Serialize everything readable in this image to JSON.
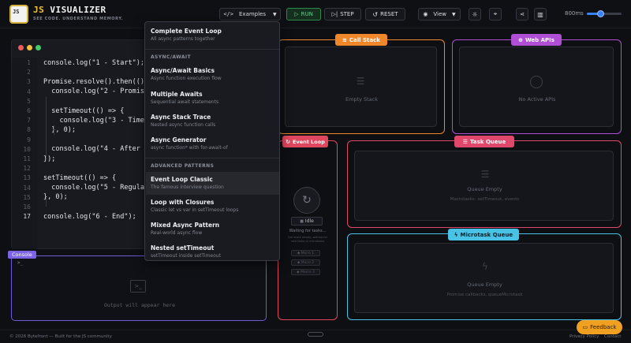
{
  "header": {
    "logo_text": "JS",
    "title_prefix": "JS",
    "title_main": "VISUALIZER",
    "tagline": "SEE CODE. UNDERSTAND MEMORY.",
    "examples_label": "Examples",
    "run_label": "RUN",
    "step_label": "STEP",
    "reset_label": "RESET",
    "view_label": "View",
    "speed_value": "800ms"
  },
  "editor": {
    "lines": [
      {
        "n": "1",
        "code": "console.log(\"1 - Start\");"
      },
      {
        "n": "2",
        "code": ""
      },
      {
        "n": "3",
        "code": "Promise.resolve().then(() => {"
      },
      {
        "n": "4",
        "code": "  console.log(\"2 - Promise"
      },
      {
        "n": "5",
        "code": ""
      },
      {
        "n": "6",
        "code": "  setTimeout(() => {"
      },
      {
        "n": "7",
        "code": "    console.log(\"3 - Timeo"
      },
      {
        "n": "8",
        "code": "  }, 0);"
      },
      {
        "n": "9",
        "code": ""
      },
      {
        "n": "10",
        "code": "  console.log(\"4 - After t"
      },
      {
        "n": "11",
        "code": "});"
      },
      {
        "n": "12",
        "code": ""
      },
      {
        "n": "13",
        "code": "setTimeout(() => {"
      },
      {
        "n": "14",
        "code": "  console.log(\"5 - Regular"
      },
      {
        "n": "15",
        "code": "}, 0);"
      },
      {
        "n": "16",
        "code": ""
      },
      {
        "n": "17",
        "code": "console.log(\"6 - End\");"
      }
    ]
  },
  "console": {
    "label": "Console",
    "prompt": ">_",
    "empty": "Output will appear here"
  },
  "dropdown": {
    "items_top": [
      {
        "title": "Complete Event Loop",
        "sub": "All async patterns together"
      }
    ],
    "section1": "ASYNC/AWAIT",
    "items1": [
      {
        "title": "Async/Await Basics",
        "sub": "Async function execution flow"
      },
      {
        "title": "Multiple Awaits",
        "sub": "Sequential await statements"
      },
      {
        "title": "Async Stack Trace",
        "sub": "Nested async function calls"
      },
      {
        "title": "Async Generator",
        "sub": "async function* with for-await-of"
      }
    ],
    "section2": "ADVANCED PATTERNS",
    "items2": [
      {
        "title": "Event Loop Classic",
        "sub": "The famous interview question"
      },
      {
        "title": "Loop with Closures",
        "sub": "Classic let vs var in setTimeout loops"
      },
      {
        "title": "Mixed Async Pattern",
        "sub": "Real-world async flow"
      },
      {
        "title": "Nested setTimeout",
        "sub": "setTimeout inside setTimeout"
      }
    ]
  },
  "call_stack": {
    "label": "Call Stack",
    "empty": "Empty Stack"
  },
  "web_apis": {
    "label": "Web APIs",
    "empty": "No Active APIs"
  },
  "event_loop": {
    "label": "Event Loop",
    "status": "Idle",
    "waiting": "Waiting for tasks...",
    "note": "Call stack empty, waiting for new tasks or microtasks",
    "steps": [
      "Micro 1",
      "Micro 2",
      "Macro 3"
    ]
  },
  "task_queue": {
    "label": "Task Queue",
    "empty": "Queue Empty",
    "sub": "Macrotasks: setTimeout, events"
  },
  "microtask_queue": {
    "label": "Microtask Queue",
    "empty": "Queue Empty",
    "sub": "Promise callbacks, queueMicrotask"
  },
  "footer": {
    "copyright": "© 2026 Bytefront — Built for the JS community",
    "privacy": "Privacy Policy",
    "contact": "Contact",
    "feedback": "Feedback"
  },
  "colors": {
    "call_stack": "#f0872a",
    "web_apis": "#b04fd6",
    "event_loop": "#e0475e",
    "task_queue": "#e0476a",
    "microtask": "#48c3e6",
    "console": "#7c63e6"
  }
}
